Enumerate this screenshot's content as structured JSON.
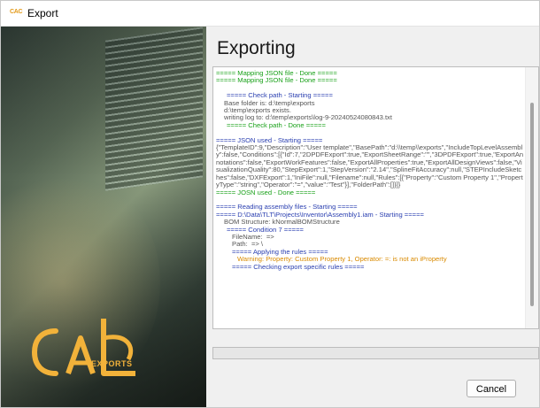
{
  "window": {
    "title": "Export",
    "app_icon_text": "CAC"
  },
  "brand": {
    "logo_text": "EXPORTS",
    "accent_color": "#f2b23a"
  },
  "main": {
    "heading": "Exporting",
    "log_lines": [
      {
        "text": "===== Mapping JSON file - Done =====",
        "color": "g",
        "indent": 0
      },
      {
        "text": "===== Mapping JSON file - Done =====",
        "color": "g",
        "indent": 0
      },
      {
        "text": "",
        "color": "k",
        "indent": 0
      },
      {
        "text": "===== Check path - Starting =====",
        "color": "b",
        "indent": 12
      },
      {
        "text": "Base folder is: d:\\temp\\exports",
        "color": "k",
        "indent": 9
      },
      {
        "text": "d:\\temp\\exports exists.",
        "color": "k",
        "indent": 9
      },
      {
        "text": "writing log to: d:\\temp\\exports\\log-9-20240524080843.txt",
        "color": "k",
        "indent": 9
      },
      {
        "text": "===== Check path - Done =====",
        "color": "g",
        "indent": 12
      },
      {
        "text": "",
        "color": "k",
        "indent": 0
      },
      {
        "text": "===== JSON used - Starting =====",
        "color": "b",
        "indent": 0
      },
      {
        "text": "{\"TemplateID\":9,\"Description\":\"User template\",\"BasePath\":\"d:\\\\temp\\\\exports\",\"IncludeTopLevelAssembly\":false,\"Conditions\":[{\"Id\":7,\"2DPDFExport\":true,\"ExportSheetRange\":\"\",\"3DPDFExport\":true,\"ExportAnnotations\":false,\"ExportWorkFeatures\":false,\"ExportAllProperties\":true,\"ExportAllDesignViews\":false,\"VisualizationQuality\":80,\"StepExport\":1,\"StepVersion\":\"2.14\",\"SplineFitAccuracy\":null,\"STEPIncludeSketches\":false,\"DXFExport\":1,\"IniFile\":null,\"Filename\":null,\"Rules\":[{\"Property\":\"Custom Property 1\",\"PropertyType\":\"string\",\"Operator\":\"=\",\"value\":\"Test\"}],\"FolderPath\":[]}]}",
        "color": "k",
        "indent": 0
      },
      {
        "text": "===== JOSN used - Done =====",
        "color": "g",
        "indent": 0
      },
      {
        "text": "",
        "color": "k",
        "indent": 0
      },
      {
        "text": "===== Reading assembly files - Starting =====",
        "color": "b",
        "indent": 0
      },
      {
        "text": "===== D:\\Data\\TLT\\Projects\\Inventor\\Assembly1.iam - Starting =====",
        "color": "b",
        "indent": 0
      },
      {
        "text": "BOM Structure: kNormalBOMStructure",
        "color": "k",
        "indent": 9
      },
      {
        "text": "===== Condition 7 =====",
        "color": "b",
        "indent": 12
      },
      {
        "text": "FileName:  =>",
        "color": "k",
        "indent": 18
      },
      {
        "text": "Path:  => \\",
        "color": "k",
        "indent": 18
      },
      {
        "text": "===== Applying the rules =====",
        "color": "b",
        "indent": 18
      },
      {
        "text": "Warning: Property: Custom Property 1, Operator: =: is not an iProperty",
        "color": "o",
        "indent": 24
      },
      {
        "text": "===== Checking export specific rules =====",
        "color": "b",
        "indent": 18
      }
    ]
  },
  "progress": {
    "value": 0.0
  },
  "footer": {
    "cancel_label": "Cancel"
  }
}
